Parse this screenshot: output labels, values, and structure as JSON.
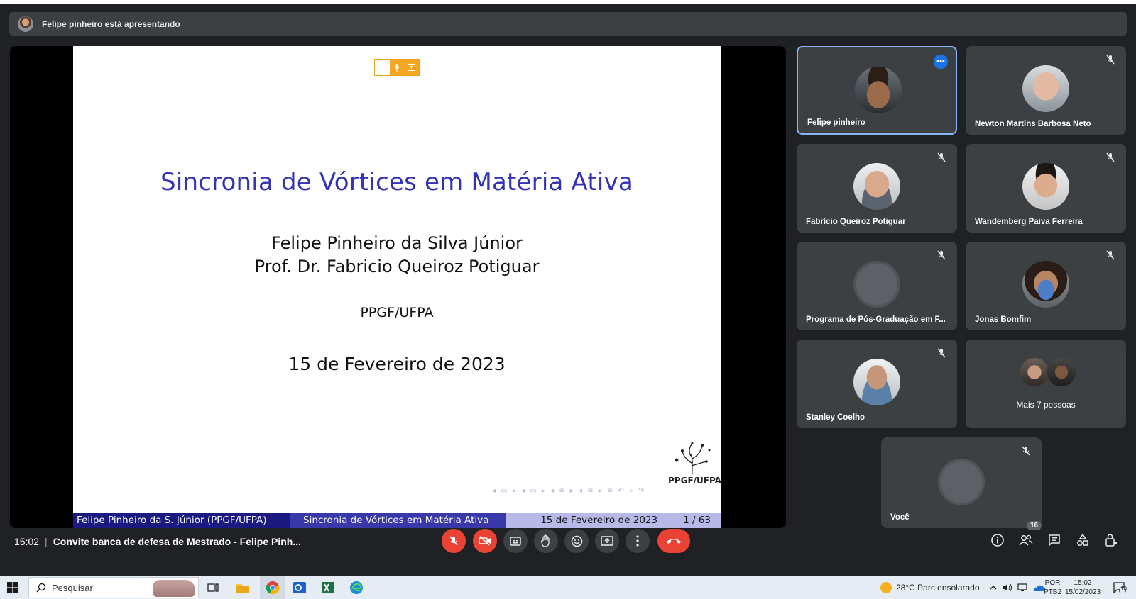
{
  "presenting": {
    "text": "Felipe pinheiro está apresentando"
  },
  "slide": {
    "title": "Sincronia de Vórtices em Matéria Ativa",
    "author": "Felipe Pinheiro da Silva Júnior",
    "advisor": "Prof. Dr. Fabricio Queiroz Potiguar",
    "institution": "PPGF/UFPA",
    "date": "15 de Fevereiro de 2023",
    "logo_text": "PPGF/UFPA",
    "footer": {
      "author": "Felipe Pinheiro da S. Júnior  (PPGF/UFPA)",
      "title": "Sincronia de Vórtices em Matéria Ativa",
      "date": "15 de Fevereiro de 2023",
      "page": "1 / 63"
    }
  },
  "participants": [
    {
      "name": "Felipe pinheiro",
      "icon": "more-options-icon",
      "active": true
    },
    {
      "name": "Newton Martins Barbosa Neto",
      "icon": "mic-off-icon"
    },
    {
      "name": "Fabrício Queiroz Potiguar",
      "icon": "mic-off-icon"
    },
    {
      "name": "Wandemberg Paiva Ferreira",
      "icon": "mic-off-icon"
    },
    {
      "name": "Programa de Pós-Graduação em F...",
      "icon": "mic-off-icon"
    },
    {
      "name": "Jonas Bomfim",
      "icon": "mic-off-icon"
    },
    {
      "name": "Stanley Coelho",
      "icon": "mic-off-icon"
    },
    {
      "name": "Mais 7 pessoas"
    },
    {
      "name": "Você",
      "icon": "mic-off-icon"
    }
  ],
  "meeting": {
    "time": "15:02",
    "title": "Convite banca de defesa de Mestrado - Felipe Pinh...",
    "participants_count": "16"
  },
  "taskbar": {
    "search_placeholder": "Pesquisar",
    "weather": "28°C  Parc ensolarado",
    "lang_top": "POR",
    "lang_bottom": "PTB2",
    "clock_time": "15:02",
    "clock_date": "15/02/2023",
    "notifications": "10"
  },
  "colors": {
    "meet_bg": "#202124",
    "tile_bg": "#3c4043",
    "danger": "#ea4335",
    "accent": "#8ab4f8",
    "slide_title": "#3333b3"
  }
}
